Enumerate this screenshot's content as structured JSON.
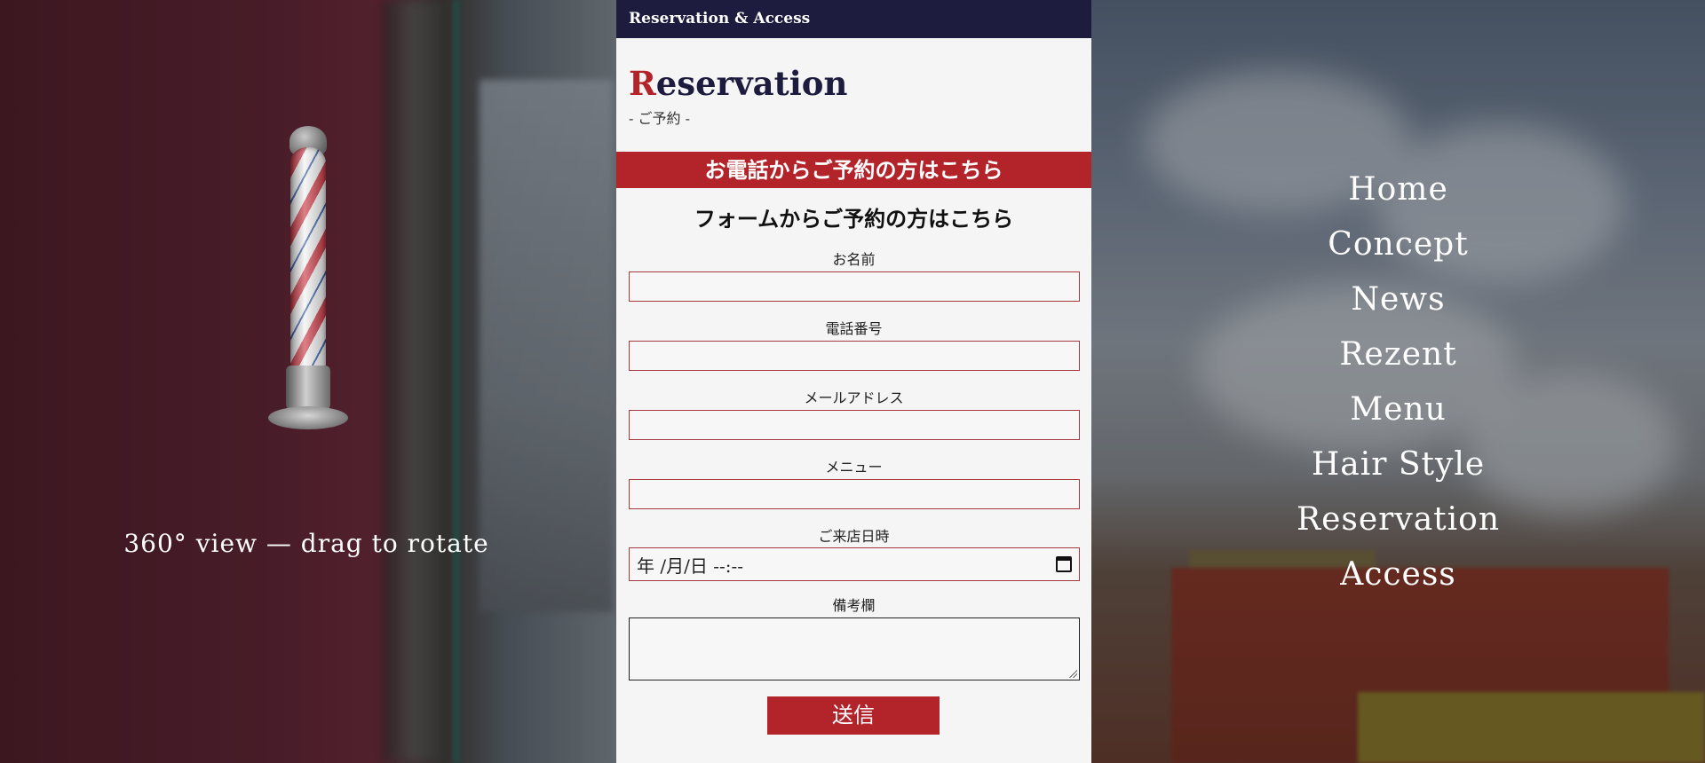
{
  "left_panel": {
    "caption": "360° view — drag to rotate"
  },
  "header": {
    "title": "Reservation & Access"
  },
  "section": {
    "title_initial": "R",
    "title_rest": "eservation",
    "subtitle": "- ご予約 -"
  },
  "phone_banner": "お電話からご予約の方はこちら",
  "form": {
    "heading": "フォームからご予約の方はこちら",
    "name_label": "お名前",
    "phone_label": "電話番号",
    "email_label": "メールアドレス",
    "menu_label": "メニュー",
    "datetime_label": "ご来店日時",
    "datetime_placeholder": "年 /月/日 --:--",
    "notes_label": "備考欄",
    "submit_label": "送信"
  },
  "nav": {
    "items": [
      "Home",
      "Concept",
      "News",
      "Rezent",
      "Menu",
      "Hair Style",
      "Reservation",
      "Access"
    ]
  },
  "colors": {
    "navy": "#1d1c3f",
    "accent_red": "#b3232a"
  }
}
